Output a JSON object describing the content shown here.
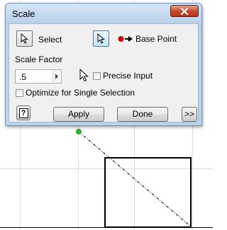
{
  "dialog": {
    "title": "Scale",
    "select_label": "Select",
    "base_point_label": "Base Point",
    "scale_factor_label": "Scale Factor",
    "scale_factor_value": ".5",
    "precise_input_label": "Precise Input",
    "precise_input_checked": false,
    "optimize_label": "Optimize for Single Selection",
    "optimize_checked": false,
    "help_label": "?",
    "apply_label": "Apply",
    "done_label": "Done",
    "more_label": ">>"
  },
  "colors": {
    "base_point_marker": "#cc0000",
    "point_marker": "#2eb82e",
    "grid_line": "#dcdcdc",
    "rectangle": "#000000"
  },
  "icons": [
    "pointer-icon",
    "pointer-icon",
    "base-point-icon",
    "close-icon",
    "help-icon",
    "spin-arrow-icon",
    "mouse-cursor-icon"
  ]
}
